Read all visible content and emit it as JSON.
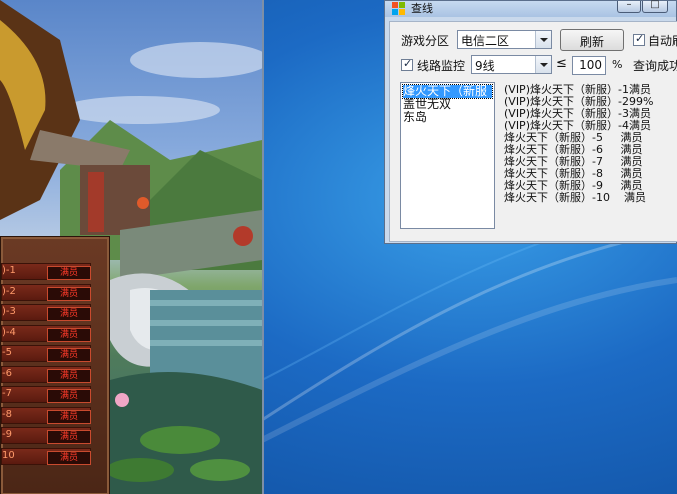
{
  "game": {
    "servers": [
      {
        "label": ")-1",
        "status": "满员"
      },
      {
        "label": ")-2",
        "status": "满员"
      },
      {
        "label": ")-3",
        "status": "满员"
      },
      {
        "label": ")-4",
        "status": "满员"
      },
      {
        "label": "-5",
        "status": "满员"
      },
      {
        "label": "-6",
        "status": "满员"
      },
      {
        "label": "-7",
        "status": "满员"
      },
      {
        "label": "-8",
        "status": "满员"
      },
      {
        "label": "-9",
        "status": "满员"
      },
      {
        "label": "10",
        "status": "满员"
      }
    ]
  },
  "window": {
    "title": "查线",
    "minimize": "–",
    "maximize": "□"
  },
  "form": {
    "zone_label": "游戏分区",
    "zone_value": "电信二区",
    "refresh_label": "刷新",
    "auto_label": "自动刷",
    "monitor_label": "线路监控",
    "line_value": "9线",
    "le_symbol": "≤",
    "threshold_value": "100",
    "percent_symbol": "%",
    "status_text": "查询成功"
  },
  "server_list": [
    "烽火天下（新服",
    "盖世无双",
    "东岛"
  ],
  "results": [
    "(VIP)烽火天下（新服）-1满员",
    "(VIP)烽火天下（新服）-299%",
    "(VIP)烽火天下（新服）-3满员",
    "(VIP)烽火天下（新服）-4满员",
    "烽火天下（新服）-5     满员",
    "烽火天下（新服）-6     满员",
    "烽火天下（新服）-7     满员",
    "烽火天下（新服）-8     满员",
    "烽火天下（新服）-9     满员",
    "烽火天下（新服）-10    满员"
  ]
}
